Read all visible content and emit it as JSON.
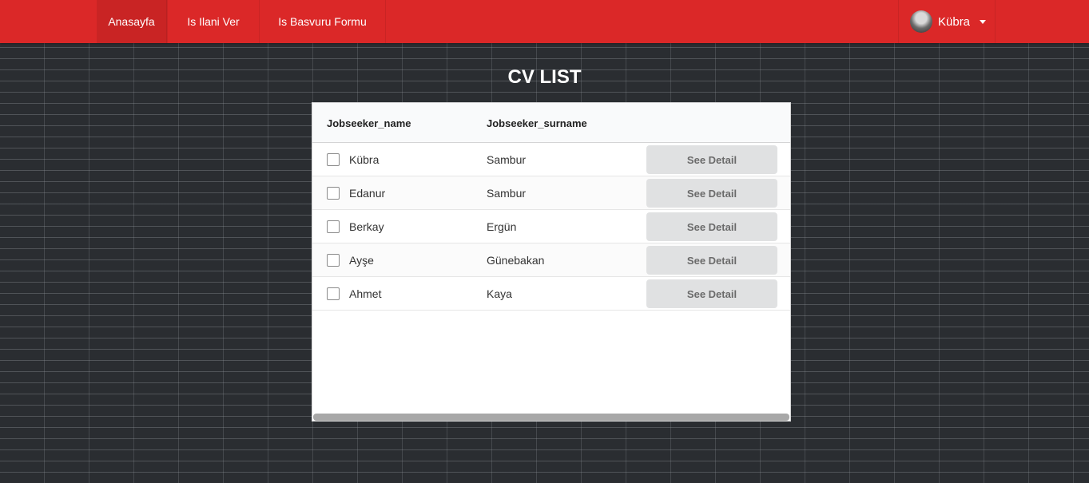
{
  "nav": {
    "items": [
      {
        "label": "Anasayfa"
      },
      {
        "label": "Is Ilani Ver"
      },
      {
        "label": "Is Basvuru Formu"
      }
    ],
    "user": {
      "name": "Kübra"
    }
  },
  "page": {
    "title": "CV LIST"
  },
  "table": {
    "headers": {
      "name": "Jobseeker_name",
      "surname": "Jobseeker_surname"
    },
    "rows": [
      {
        "name": "Kübra",
        "surname": "Sambur",
        "action": "See Detail"
      },
      {
        "name": "Edanur",
        "surname": "Sambur",
        "action": "See Detail"
      },
      {
        "name": "Berkay",
        "surname": "Ergün",
        "action": "See Detail"
      },
      {
        "name": "Ayşe",
        "surname": "Günebakan",
        "action": "See Detail"
      },
      {
        "name": "Ahmet",
        "surname": "Kaya",
        "action": "See Detail"
      }
    ]
  },
  "colors": {
    "navbar": "#db2828",
    "button": "#e0e1e2"
  }
}
